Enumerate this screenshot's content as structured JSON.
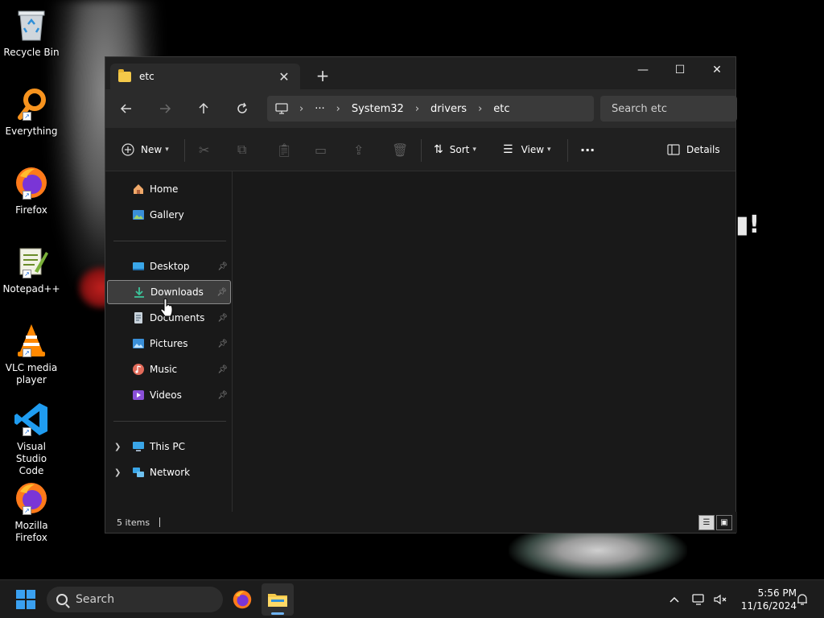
{
  "desktop": {
    "icons": [
      {
        "label": "Recycle Bin"
      },
      {
        "label": "Everything"
      },
      {
        "label": "Firefox"
      },
      {
        "label": "Notepad++"
      },
      {
        "label": "VLC media player"
      },
      {
        "label": "Visual Studio Code"
      },
      {
        "label": "Mozilla Firefox"
      }
    ]
  },
  "window": {
    "tab_title": "etc",
    "new_tab_symbol": "+",
    "breadcrumb": [
      "System32",
      "drivers",
      "etc"
    ],
    "search_placeholder": "Search etc",
    "commands": {
      "new_label": "New",
      "sort_label": "Sort",
      "view_label": "View",
      "more_label": "···",
      "details_label": "Details"
    },
    "nav": {
      "home": "Home",
      "gallery": "Gallery",
      "desktop": "Desktop",
      "downloads": "Downloads",
      "documents": "Documents",
      "pictures": "Pictures",
      "music": "Music",
      "videos": "Videos",
      "this_pc": "This PC",
      "network": "Network"
    },
    "selected_nav": "Downloads",
    "status_text": "5 items"
  },
  "taskbar": {
    "search_placeholder": "Search",
    "time": "5:56 PM",
    "date": "11/16/2024"
  },
  "colors": {
    "accent": "#3aa0f0",
    "folder": "#f4c94a",
    "window_bg": "#191919"
  }
}
